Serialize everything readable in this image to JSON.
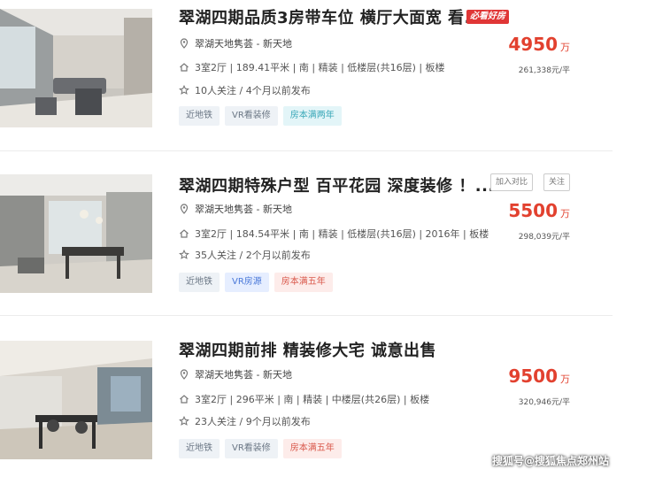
{
  "listings": [
    {
      "title": "翠湖四期品质3房带车位 横厅大面宽 看...",
      "badge": "必看好房",
      "location": "翠湖天地隽荟 - 新天地",
      "info": "3室2厅 | 189.41平米 | 南 | 精装 | 低楼层(共16层) | 板楼",
      "follow": "10人关注 / 4个月以前发布",
      "tags": [
        "近地铁",
        "VR看装修",
        "房本满两年"
      ],
      "price": "4950",
      "price_unit": "万",
      "unit_price": "261,338元/平"
    },
    {
      "title": "翠湖四期特殊户型 百平花园 深度装修 ！...",
      "compare_label": "加入对比",
      "follow_label": "关注",
      "location": "翠湖天地隽荟 - 新天地",
      "info": "3室2厅 | 184.54平米 | 南 | 精装 | 低楼层(共16层) | 2016年 | 板楼",
      "follow": "35人关注 / 2个月以前发布",
      "tags": [
        "近地铁",
        "VR房源",
        "房本满五年"
      ],
      "price": "5500",
      "price_unit": "万",
      "unit_price": "298,039元/平"
    },
    {
      "title": "翠湖四期前排 精装修大宅 诚意出售",
      "location": "翠湖天地隽荟 - 新天地",
      "info": "3室2厅 | 296平米 | 南 | 精装 | 中楼层(共26层) | 板楼",
      "follow": "23人关注 / 9个月以前发布",
      "tags": [
        "近地铁",
        "VR看装修",
        "房本满五年"
      ],
      "price": "9500",
      "price_unit": "万",
      "unit_price": "320,946元/平"
    }
  ],
  "watermark": "搜狐号@搜狐焦点郑州站",
  "colors": {
    "price": "#e2412f",
    "badge": "#e03636"
  }
}
